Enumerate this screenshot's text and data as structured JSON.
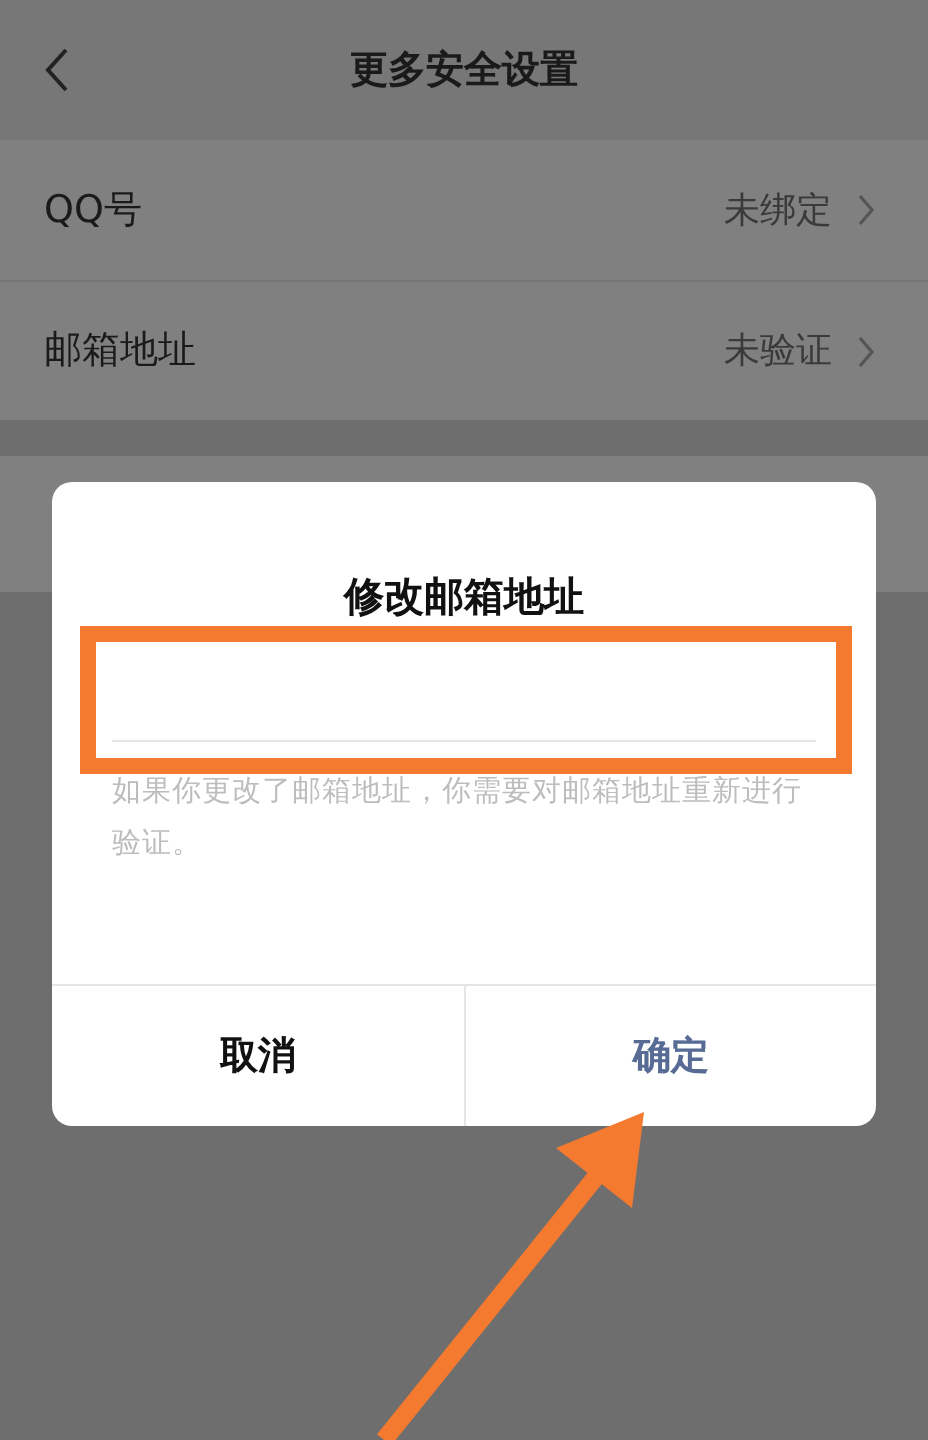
{
  "header": {
    "title": "更多安全设置"
  },
  "rows": [
    {
      "label": "QQ号",
      "value": "未绑定"
    },
    {
      "label": "邮箱地址",
      "value": "未验证"
    }
  ],
  "dialog": {
    "title": "修改邮箱地址",
    "hint": "如果你更改了邮箱地址，你需要对邮箱地址重新进行验证。",
    "buttons": [
      {
        "label": "取消",
        "kind": "cancel"
      },
      {
        "label": "确定",
        "kind": "confirm"
      }
    ]
  }
}
